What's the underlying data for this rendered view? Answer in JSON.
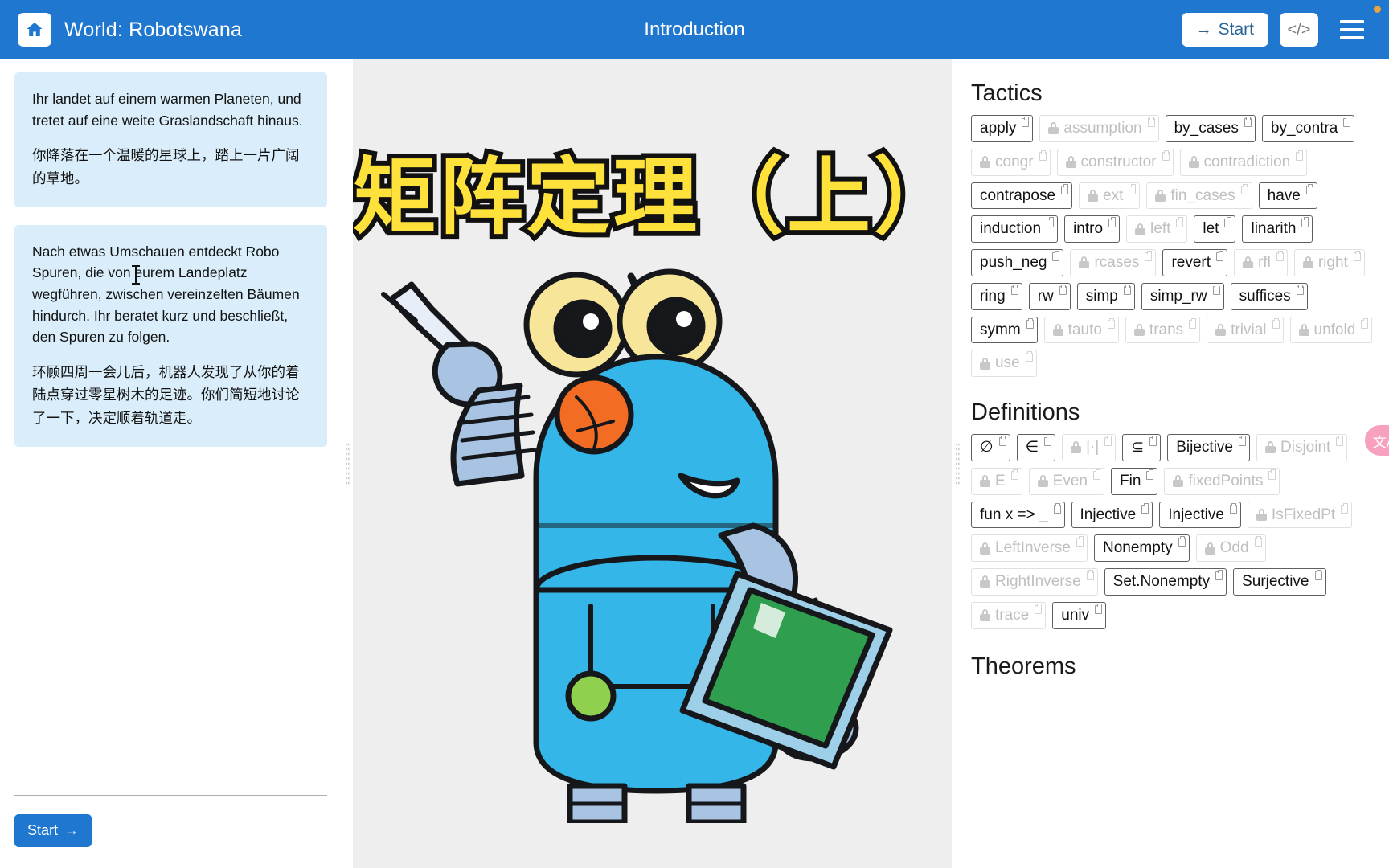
{
  "header": {
    "home_icon": "home-icon",
    "world_title": "World: Robotswana",
    "page_title": "Introduction",
    "start_label": "Start",
    "start_arrow": "→",
    "code_icon_label": "</>",
    "menu_icon": "hamburger-menu-icon",
    "notification_dot_color": "#e8a33d",
    "background_color": "#1f77cf"
  },
  "left_panel": {
    "story_blocks": [
      {
        "de": "Ihr landet auf einem warmen Planeten, und tretet auf eine weite Graslandschaft hinaus.",
        "zh": "你降落在一个温暖的星球上，踏上一片广阔的草地。"
      },
      {
        "de": "Nach etwas Umschauen entdeckt Robo Spuren, die von eurem Landeplatz wegführen, zwischen vereinzelten Bäumen hindurch. Ihr beratet kurz und beschließt, den Spuren zu folgen.",
        "zh": "环顾四周一会儿后，机器人发现了从你的着陆点穿过零星树木的足迹。你们简短地讨论了一下，决定顺着轨道走。"
      }
    ],
    "start_button": "Start",
    "start_arrow": "→"
  },
  "center_panel": {
    "hero_title": "矩阵定理（上）",
    "hero_title_fill": "#ffe13b",
    "hero_title_stroke": "#111111",
    "illustration": "robot-with-pen-and-tablet",
    "background_color": "#eeeeee"
  },
  "right_panel": {
    "tactics_title": "Tactics",
    "tactics": [
      {
        "label": "apply",
        "locked": false
      },
      {
        "label": "assumption",
        "locked": true
      },
      {
        "label": "by_cases",
        "locked": false
      },
      {
        "label": "by_contra",
        "locked": false
      },
      {
        "label": "congr",
        "locked": true
      },
      {
        "label": "constructor",
        "locked": true
      },
      {
        "label": "contradiction",
        "locked": true
      },
      {
        "label": "contrapose",
        "locked": false
      },
      {
        "label": "ext",
        "locked": true
      },
      {
        "label": "fin_cases",
        "locked": true
      },
      {
        "label": "have",
        "locked": false
      },
      {
        "label": "induction",
        "locked": false
      },
      {
        "label": "intro",
        "locked": false
      },
      {
        "label": "left",
        "locked": true
      },
      {
        "label": "let",
        "locked": false
      },
      {
        "label": "linarith",
        "locked": false
      },
      {
        "label": "push_neg",
        "locked": false
      },
      {
        "label": "rcases",
        "locked": true
      },
      {
        "label": "revert",
        "locked": false
      },
      {
        "label": "rfl",
        "locked": true
      },
      {
        "label": "right",
        "locked": true
      },
      {
        "label": "ring",
        "locked": false
      },
      {
        "label": "rw",
        "locked": false
      },
      {
        "label": "simp",
        "locked": false
      },
      {
        "label": "simp_rw",
        "locked": false
      },
      {
        "label": "suffices",
        "locked": false
      },
      {
        "label": "symm",
        "locked": false
      },
      {
        "label": "tauto",
        "locked": true
      },
      {
        "label": "trans",
        "locked": true
      },
      {
        "label": "trivial",
        "locked": true
      },
      {
        "label": "unfold",
        "locked": true
      },
      {
        "label": "use",
        "locked": true
      }
    ],
    "definitions_title": "Definitions",
    "definitions": [
      {
        "label": "∅",
        "locked": false
      },
      {
        "label": "∈",
        "locked": false
      },
      {
        "label": "|·|",
        "locked": true
      },
      {
        "label": "⊆",
        "locked": false
      },
      {
        "label": "Bijective",
        "locked": false
      },
      {
        "label": "Disjoint",
        "locked": true
      },
      {
        "label": "E",
        "locked": true
      },
      {
        "label": "Even",
        "locked": true
      },
      {
        "label": "Fin",
        "locked": false
      },
      {
        "label": "fixedPoints",
        "locked": true
      },
      {
        "label": "fun x => _",
        "locked": false
      },
      {
        "label": "Injective",
        "locked": false
      },
      {
        "label": "Injective",
        "locked": false
      },
      {
        "label": "IsFixedPt",
        "locked": true
      },
      {
        "label": "LeftInverse",
        "locked": true
      },
      {
        "label": "Nonempty",
        "locked": false
      },
      {
        "label": "Odd",
        "locked": true
      },
      {
        "label": "RightInverse",
        "locked": true
      },
      {
        "label": "Set.Nonempty",
        "locked": false
      },
      {
        "label": "Surjective",
        "locked": false
      },
      {
        "label": "trace",
        "locked": true
      },
      {
        "label": "univ",
        "locked": false
      }
    ],
    "theorems_title": "Theorems",
    "translate_widget_label": "文A",
    "translate_widget_color": "#f8a0c0"
  }
}
